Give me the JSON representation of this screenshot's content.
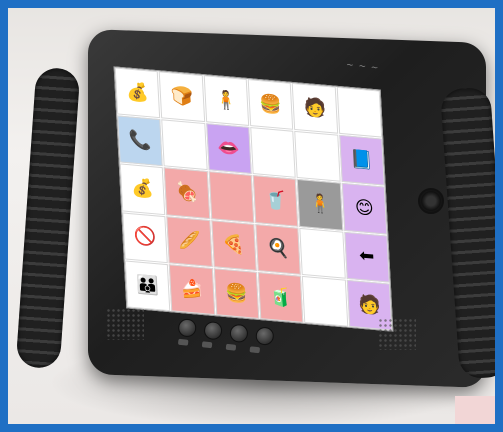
{
  "scene": {
    "description_colors": {
      "frame": "#1f6fc4",
      "device": "#2b2b2b",
      "screen": "#ffffff",
      "food_panel": "#f3a9a9",
      "accent_purple": "#c9a3f2",
      "accent_blue": "#bcd6ef"
    }
  },
  "screen": {
    "cells": [
      {
        "icon": "money-bag-icon",
        "glyph": "💰",
        "bg": "empty"
      },
      {
        "icon": "bread-icon",
        "glyph": "🍞",
        "bg": "empty"
      },
      {
        "icon": "person-icon",
        "glyph": "🧍",
        "bg": "empty"
      },
      {
        "icon": "food-icon",
        "glyph": "🍔",
        "bg": "empty"
      },
      {
        "icon": "person-icon",
        "glyph": "🧑",
        "bg": "empty"
      },
      {
        "icon": "",
        "glyph": "",
        "bg": "empty"
      },
      {
        "icon": "phone-icon",
        "glyph": "📞",
        "bg": "blue"
      },
      {
        "icon": "",
        "glyph": "",
        "bg": "empty"
      },
      {
        "icon": "lips-icon",
        "glyph": "👄",
        "bg": "purple"
      },
      {
        "icon": "",
        "glyph": "",
        "bg": "empty"
      },
      {
        "icon": "",
        "glyph": "",
        "bg": "empty"
      },
      {
        "icon": "book-icon",
        "glyph": "📘",
        "bg": "violet"
      },
      {
        "icon": "money-bag-icon",
        "glyph": "💰",
        "bg": "empty"
      },
      {
        "icon": "meat-icon",
        "glyph": "🍖",
        "bg": "red"
      },
      {
        "icon": "",
        "glyph": "",
        "bg": "red"
      },
      {
        "icon": "drink-icon",
        "glyph": "🥤",
        "bg": "red"
      },
      {
        "icon": "person-icon",
        "glyph": "🧍",
        "bg": "grey"
      },
      {
        "icon": "smile-icon",
        "glyph": "😊",
        "bg": "violet"
      },
      {
        "icon": "no-icon",
        "glyph": "🚫",
        "bg": "empty"
      },
      {
        "icon": "bread-icon",
        "glyph": "🥖",
        "bg": "red"
      },
      {
        "icon": "pizza-icon",
        "glyph": "🍕",
        "bg": "red"
      },
      {
        "icon": "egg-icon",
        "glyph": "🍳",
        "bg": "red"
      },
      {
        "icon": "",
        "glyph": "",
        "bg": "empty"
      },
      {
        "icon": "arrow-icon",
        "glyph": "⬅",
        "bg": "violet"
      },
      {
        "icon": "people-icon",
        "glyph": "👪",
        "bg": "empty"
      },
      {
        "icon": "cake-icon",
        "glyph": "🍰",
        "bg": "red"
      },
      {
        "icon": "burger-icon",
        "glyph": "🍔",
        "bg": "red"
      },
      {
        "icon": "juice-icon",
        "glyph": "🧃",
        "bg": "red"
      },
      {
        "icon": "",
        "glyph": "",
        "bg": "empty"
      },
      {
        "icon": "person-icon",
        "glyph": "🧑",
        "bg": "violet"
      }
    ]
  }
}
